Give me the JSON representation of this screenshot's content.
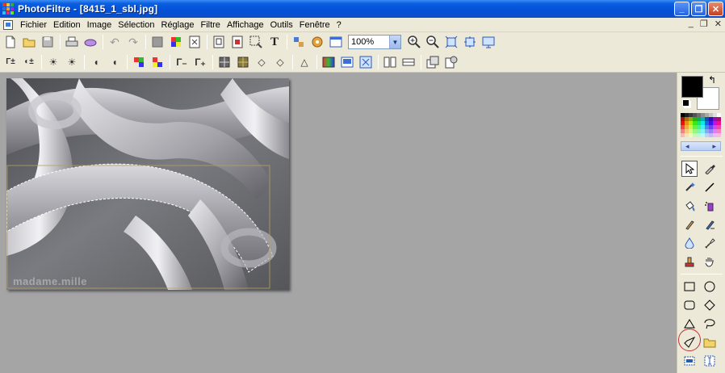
{
  "window": {
    "app_name": "PhotoFiltre",
    "title": "PhotoFiltre - [8415_1_sbl.jpg]",
    "min_label": "_",
    "max_label": "❐",
    "close_label": "✕"
  },
  "menu": {
    "items": [
      "Fichier",
      "Edition",
      "Image",
      "Sélection",
      "Réglage",
      "Filtre",
      "Affichage",
      "Outils",
      "Fenêtre",
      "?"
    ],
    "mdi_min": "_",
    "mdi_restore": "❐",
    "mdi_close": "✕"
  },
  "toolbar": {
    "zoom_value": "100%"
  },
  "image": {
    "watermark": "madame.mille",
    "filename": "8415_1_sbl.jpg"
  },
  "palette": {
    "foreground": "#000000",
    "background": "#ffffff",
    "nav_left": "◂",
    "nav_right": "▸"
  },
  "colors": {
    "titlebar": "#0550d6",
    "workspace": "#a5a5a5",
    "chrome": "#ece9d8",
    "highlight_ring": "#c43030"
  },
  "icons": {
    "toolbar1": [
      "new-file-icon",
      "open-folder-icon",
      "save-icon",
      "print-icon",
      "scan-icon",
      "undo-icon",
      "redo-icon",
      "transparency-icon",
      "color-palette-icon",
      "text-box-icon",
      "crop-icon",
      "resize-icon",
      "selection-icon",
      "text-tool-icon",
      "export-icon",
      "plugin-icon",
      "options-icon",
      "zoom-in-icon",
      "zoom-out-icon",
      "fit-window-icon",
      "actual-size-icon",
      "fullscreen-icon"
    ],
    "toolbar2": [
      "auto-levels-icon",
      "auto-contrast-icon",
      "brightness-plus-icon",
      "brightness-minus-icon",
      "contrast-plus-icon",
      "contrast-minus-icon",
      "saturation-plus-icon",
      "saturation-minus-icon",
      "gamma-minus-icon",
      "gamma-plus-icon",
      "mosaic-icon",
      "blur-icon",
      "soften-icon",
      "sharpen-icon",
      "sharpen-more-icon",
      "gradient-icon",
      "frame-icon",
      "texture-icon",
      "flip-icon",
      "rotate-icon",
      "layer-icon",
      "settings-icon"
    ],
    "tools": [
      "pointer-tool-icon",
      "eyedropper-tool-icon",
      "magic-wand-tool-icon",
      "line-tool-icon",
      "fill-tool-icon",
      "spray-tool-icon",
      "brush-tool-icon",
      "advanced-brush-tool-icon",
      "blur-tool-icon",
      "smudge-tool-icon",
      "stamp-tool-icon",
      "hand-tool-icon",
      "rectangle-select-icon",
      "ellipse-select-icon",
      "rounded-rect-select-icon",
      "diamond-select-icon",
      "triangle-select-icon",
      "lasso-icon",
      "polygon-lasso-icon",
      "open-selection-icon",
      "fill-selection-icon",
      "text-selection-icon"
    ]
  }
}
